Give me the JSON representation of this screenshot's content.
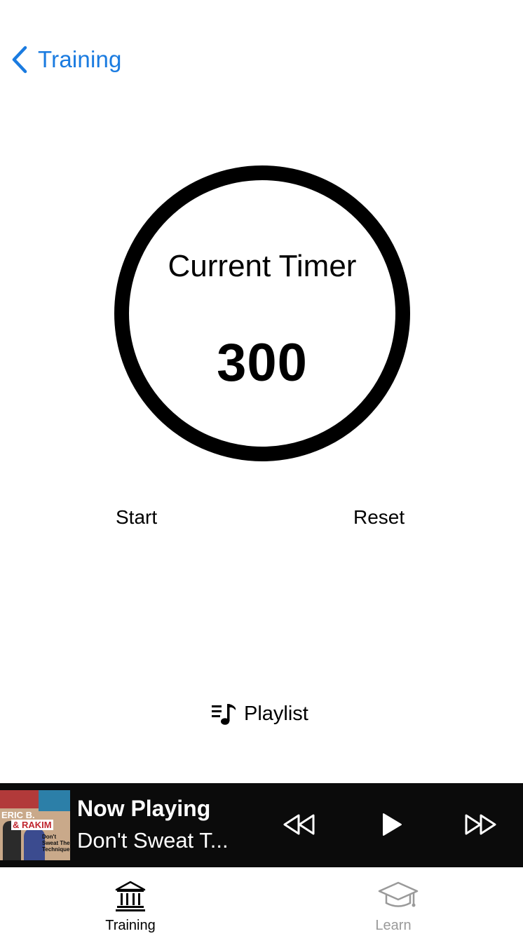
{
  "nav": {
    "back_label": "Training"
  },
  "timer": {
    "title": "Current Timer",
    "value": "300"
  },
  "controls": {
    "start_label": "Start",
    "reset_label": "Reset"
  },
  "playlist": {
    "label": "Playlist"
  },
  "now_playing": {
    "title": "Now Playing",
    "track": "Don't Sweat T...",
    "album_art": {
      "line1": "ERIC B.",
      "line2": "& RAKIM",
      "line3": "Don't Sweat The Technique"
    }
  },
  "tabs": [
    {
      "label": "Training",
      "icon": "bank-icon",
      "active": true
    },
    {
      "label": "Learn",
      "icon": "graduation-cap-icon",
      "active": false
    }
  ],
  "colors": {
    "accent": "#1a7be0",
    "player_bg": "#0b0b0b",
    "inactive_tab": "#9a9a9a"
  }
}
